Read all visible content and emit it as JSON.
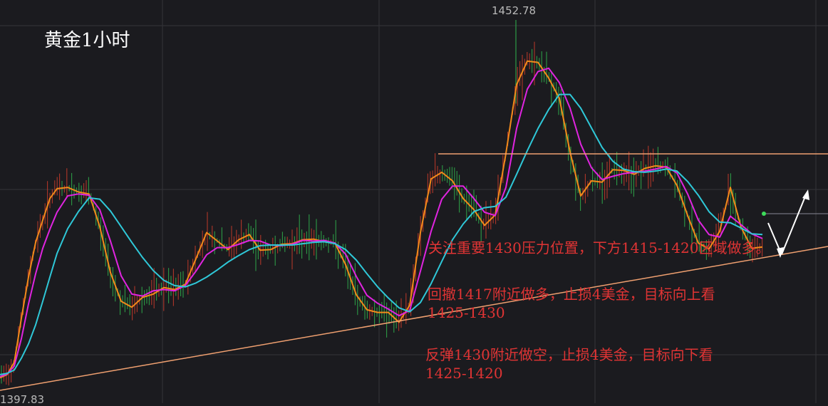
{
  "header": {
    "title": "黄金1小时"
  },
  "annotations": {
    "line1": "关注重要1430压力位置，下方1415-1420区域做多。",
    "line2a": "回撤1417附近做多，止损4美金，目标向上看",
    "line2b": "1425-1430",
    "line3a": "反弹1430附近做空，止损4美金，目标向下看",
    "line3b": "1425-1420"
  },
  "colors": {
    "background": "#1b1b1f",
    "grid": "#34343a",
    "up_candle": "#c0392b",
    "down_candle": "#2ea84a",
    "ma_fast": "#f28a1a",
    "ma_mid": "#e024e0",
    "ma_slow": "#2fc8d8",
    "resistance": "#f0a070",
    "trendline": "#f0a070",
    "annotation_text": "#e03434",
    "arrow": "#ffffff"
  },
  "chart_data": {
    "type": "line",
    "title": "黄金1小时",
    "ylim": [
      1397,
      1455
    ],
    "labels": {
      "high": "1452.78",
      "low": "1397.83"
    },
    "grid": true,
    "series": [
      {
        "name": "",
        "color_key": "ma_fast",
        "values": [
          [
            0,
            1398.1
          ],
          [
            10,
            1398.6
          ],
          [
            20,
            1400.5
          ],
          [
            30,
            1407.2
          ],
          [
            40,
            1413.5
          ],
          [
            50,
            1418.8
          ],
          [
            60,
            1422.2
          ],
          [
            70,
            1425.5
          ],
          [
            80,
            1427.0
          ],
          [
            95,
            1427.2
          ],
          [
            110,
            1426.5
          ],
          [
            125,
            1426.2
          ],
          [
            140,
            1421.2
          ],
          [
            155,
            1414.2
          ],
          [
            170,
            1409.8
          ],
          [
            185,
            1408.9
          ],
          [
            200,
            1410.4
          ],
          [
            215,
            1410.9
          ],
          [
            230,
            1411.9
          ],
          [
            245,
            1411.6
          ],
          [
            260,
            1412.4
          ],
          [
            275,
            1416.3
          ],
          [
            290,
            1420.3
          ],
          [
            305,
            1419.0
          ],
          [
            320,
            1417.7
          ],
          [
            335,
            1419.2
          ],
          [
            350,
            1420.0
          ],
          [
            365,
            1417.6
          ],
          [
            380,
            1417.7
          ],
          [
            395,
            1418.5
          ],
          [
            410,
            1418.6
          ],
          [
            425,
            1419.2
          ],
          [
            440,
            1419.3
          ],
          [
            455,
            1418.9
          ],
          [
            470,
            1418.7
          ],
          [
            485,
            1415.4
          ],
          [
            500,
            1410.8
          ],
          [
            515,
            1408.5
          ],
          [
            530,
            1408.1
          ],
          [
            545,
            1408.1
          ],
          [
            560,
            1406.6
          ],
          [
            575,
            1409.2
          ],
          [
            590,
            1420.3
          ],
          [
            605,
            1428.5
          ],
          [
            620,
            1429.5
          ],
          [
            635,
            1428.2
          ],
          [
            650,
            1425.5
          ],
          [
            665,
            1423.8
          ],
          [
            680,
            1421.4
          ],
          [
            695,
            1423.0
          ],
          [
            710,
            1432.4
          ],
          [
            725,
            1442.9
          ],
          [
            740,
            1446.5
          ],
          [
            755,
            1446.3
          ],
          [
            770,
            1443.9
          ],
          [
            785,
            1440.8
          ],
          [
            800,
            1432.6
          ],
          [
            815,
            1425.9
          ],
          [
            830,
            1428.2
          ],
          [
            845,
            1428.0
          ],
          [
            860,
            1429.9
          ],
          [
            875,
            1429.8
          ],
          [
            890,
            1429.2
          ],
          [
            905,
            1430.1
          ],
          [
            920,
            1430.5
          ],
          [
            935,
            1430.3
          ],
          [
            950,
            1427.5
          ],
          [
            965,
            1422.9
          ],
          [
            980,
            1418.7
          ],
          [
            995,
            1417.8
          ],
          [
            1010,
            1420.5
          ],
          [
            1025,
            1427.2
          ],
          [
            1040,
            1421.1
          ],
          [
            1055,
            1417.9
          ],
          [
            1070,
            1418.1
          ]
        ]
      },
      {
        "name": "",
        "color_key": "ma_mid",
        "values": [
          [
            0,
            1398.3
          ],
          [
            10,
            1398.7
          ],
          [
            20,
            1399.9
          ],
          [
            30,
            1404.1
          ],
          [
            40,
            1409.4
          ],
          [
            50,
            1414.0
          ],
          [
            60,
            1417.9
          ],
          [
            70,
            1420.8
          ],
          [
            80,
            1423.4
          ],
          [
            95,
            1425.9
          ],
          [
            110,
            1426.2
          ],
          [
            125,
            1426.0
          ],
          [
            140,
            1423.8
          ],
          [
            155,
            1419.0
          ],
          [
            170,
            1413.7
          ],
          [
            185,
            1410.9
          ],
          [
            200,
            1410.6
          ],
          [
            215,
            1411.4
          ],
          [
            230,
            1411.6
          ],
          [
            245,
            1411.4
          ],
          [
            260,
            1412.2
          ],
          [
            275,
            1414.4
          ],
          [
            290,
            1416.9
          ],
          [
            305,
            1418.0
          ],
          [
            320,
            1418.0
          ],
          [
            335,
            1418.5
          ],
          [
            350,
            1419.1
          ],
          [
            365,
            1419.0
          ],
          [
            380,
            1418.4
          ],
          [
            395,
            1418.3
          ],
          [
            410,
            1418.5
          ],
          [
            425,
            1419.1
          ],
          [
            440,
            1419.0
          ],
          [
            455,
            1419.1
          ],
          [
            470,
            1418.7
          ],
          [
            485,
            1417.0
          ],
          [
            500,
            1413.6
          ],
          [
            515,
            1410.7
          ],
          [
            530,
            1409.5
          ],
          [
            545,
            1408.6
          ],
          [
            560,
            1407.6
          ],
          [
            575,
            1408.4
          ],
          [
            590,
            1414.4
          ],
          [
            605,
            1420.5
          ],
          [
            620,
            1425.4
          ],
          [
            635,
            1427.4
          ],
          [
            650,
            1427.4
          ],
          [
            665,
            1425.5
          ],
          [
            680,
            1423.4
          ],
          [
            695,
            1422.9
          ],
          [
            710,
            1427.2
          ],
          [
            725,
            1436.2
          ],
          [
            740,
            1442.2
          ],
          [
            755,
            1444.9
          ],
          [
            770,
            1445.4
          ],
          [
            785,
            1443.2
          ],
          [
            800,
            1439.3
          ],
          [
            815,
            1433.8
          ],
          [
            830,
            1430.2
          ],
          [
            845,
            1428.4
          ],
          [
            860,
            1428.9
          ],
          [
            875,
            1429.3
          ],
          [
            890,
            1429.5
          ],
          [
            905,
            1429.7
          ],
          [
            920,
            1430.0
          ],
          [
            935,
            1430.4
          ],
          [
            950,
            1429.4
          ],
          [
            965,
            1426.2
          ],
          [
            980,
            1422.2
          ],
          [
            995,
            1420.0
          ],
          [
            1010,
            1419.6
          ],
          [
            1025,
            1422.8
          ],
          [
            1040,
            1421.5
          ],
          [
            1055,
            1420.1
          ],
          [
            1070,
            1419.4
          ]
        ]
      },
      {
        "name": "",
        "color_key": "ma_slow",
        "values": [
          [
            0,
            1398.6
          ],
          [
            10,
            1398.8
          ],
          [
            20,
            1399.3
          ],
          [
            30,
            1401.1
          ],
          [
            40,
            1403.3
          ],
          [
            50,
            1406.2
          ],
          [
            60,
            1409.8
          ],
          [
            70,
            1413.5
          ],
          [
            80,
            1417.1
          ],
          [
            95,
            1420.9
          ],
          [
            110,
            1423.5
          ],
          [
            125,
            1425.6
          ],
          [
            140,
            1425.4
          ],
          [
            155,
            1423.6
          ],
          [
            170,
            1421.2
          ],
          [
            185,
            1418.8
          ],
          [
            200,
            1416.5
          ],
          [
            215,
            1414.5
          ],
          [
            230,
            1413.0
          ],
          [
            245,
            1412.2
          ],
          [
            260,
            1412.0
          ],
          [
            275,
            1412.6
          ],
          [
            290,
            1413.5
          ],
          [
            305,
            1414.6
          ],
          [
            320,
            1415.8
          ],
          [
            335,
            1416.8
          ],
          [
            350,
            1417.7
          ],
          [
            365,
            1418.3
          ],
          [
            380,
            1418.4
          ],
          [
            395,
            1418.4
          ],
          [
            410,
            1418.4
          ],
          [
            425,
            1418.6
          ],
          [
            440,
            1418.8
          ],
          [
            455,
            1418.9
          ],
          [
            470,
            1418.6
          ],
          [
            485,
            1417.7
          ],
          [
            500,
            1416.1
          ],
          [
            515,
            1414.0
          ],
          [
            530,
            1412.0
          ],
          [
            545,
            1410.3
          ],
          [
            560,
            1408.8
          ],
          [
            575,
            1408.2
          ],
          [
            590,
            1409.6
          ],
          [
            605,
            1412.5
          ],
          [
            620,
            1415.9
          ],
          [
            635,
            1419.2
          ],
          [
            650,
            1421.6
          ],
          [
            665,
            1423.5
          ],
          [
            680,
            1424.1
          ],
          [
            695,
            1424.3
          ],
          [
            710,
            1425.7
          ],
          [
            725,
            1429.2
          ],
          [
            740,
            1432.8
          ],
          [
            755,
            1436.2
          ],
          [
            770,
            1439.1
          ],
          [
            785,
            1441.4
          ],
          [
            800,
            1441.4
          ],
          [
            815,
            1439.3
          ],
          [
            830,
            1436.3
          ],
          [
            845,
            1433.3
          ],
          [
            860,
            1431.2
          ],
          [
            875,
            1430.0
          ],
          [
            890,
            1429.6
          ],
          [
            905,
            1429.5
          ],
          [
            920,
            1429.7
          ],
          [
            935,
            1430.0
          ],
          [
            950,
            1429.7
          ],
          [
            965,
            1428.1
          ],
          [
            980,
            1426.0
          ],
          [
            995,
            1423.5
          ],
          [
            1010,
            1421.9
          ],
          [
            1025,
            1421.8
          ],
          [
            1040,
            1421.0
          ],
          [
            1055,
            1420.1
          ],
          [
            1070,
            1420.0
          ]
        ]
      }
    ]
  }
}
